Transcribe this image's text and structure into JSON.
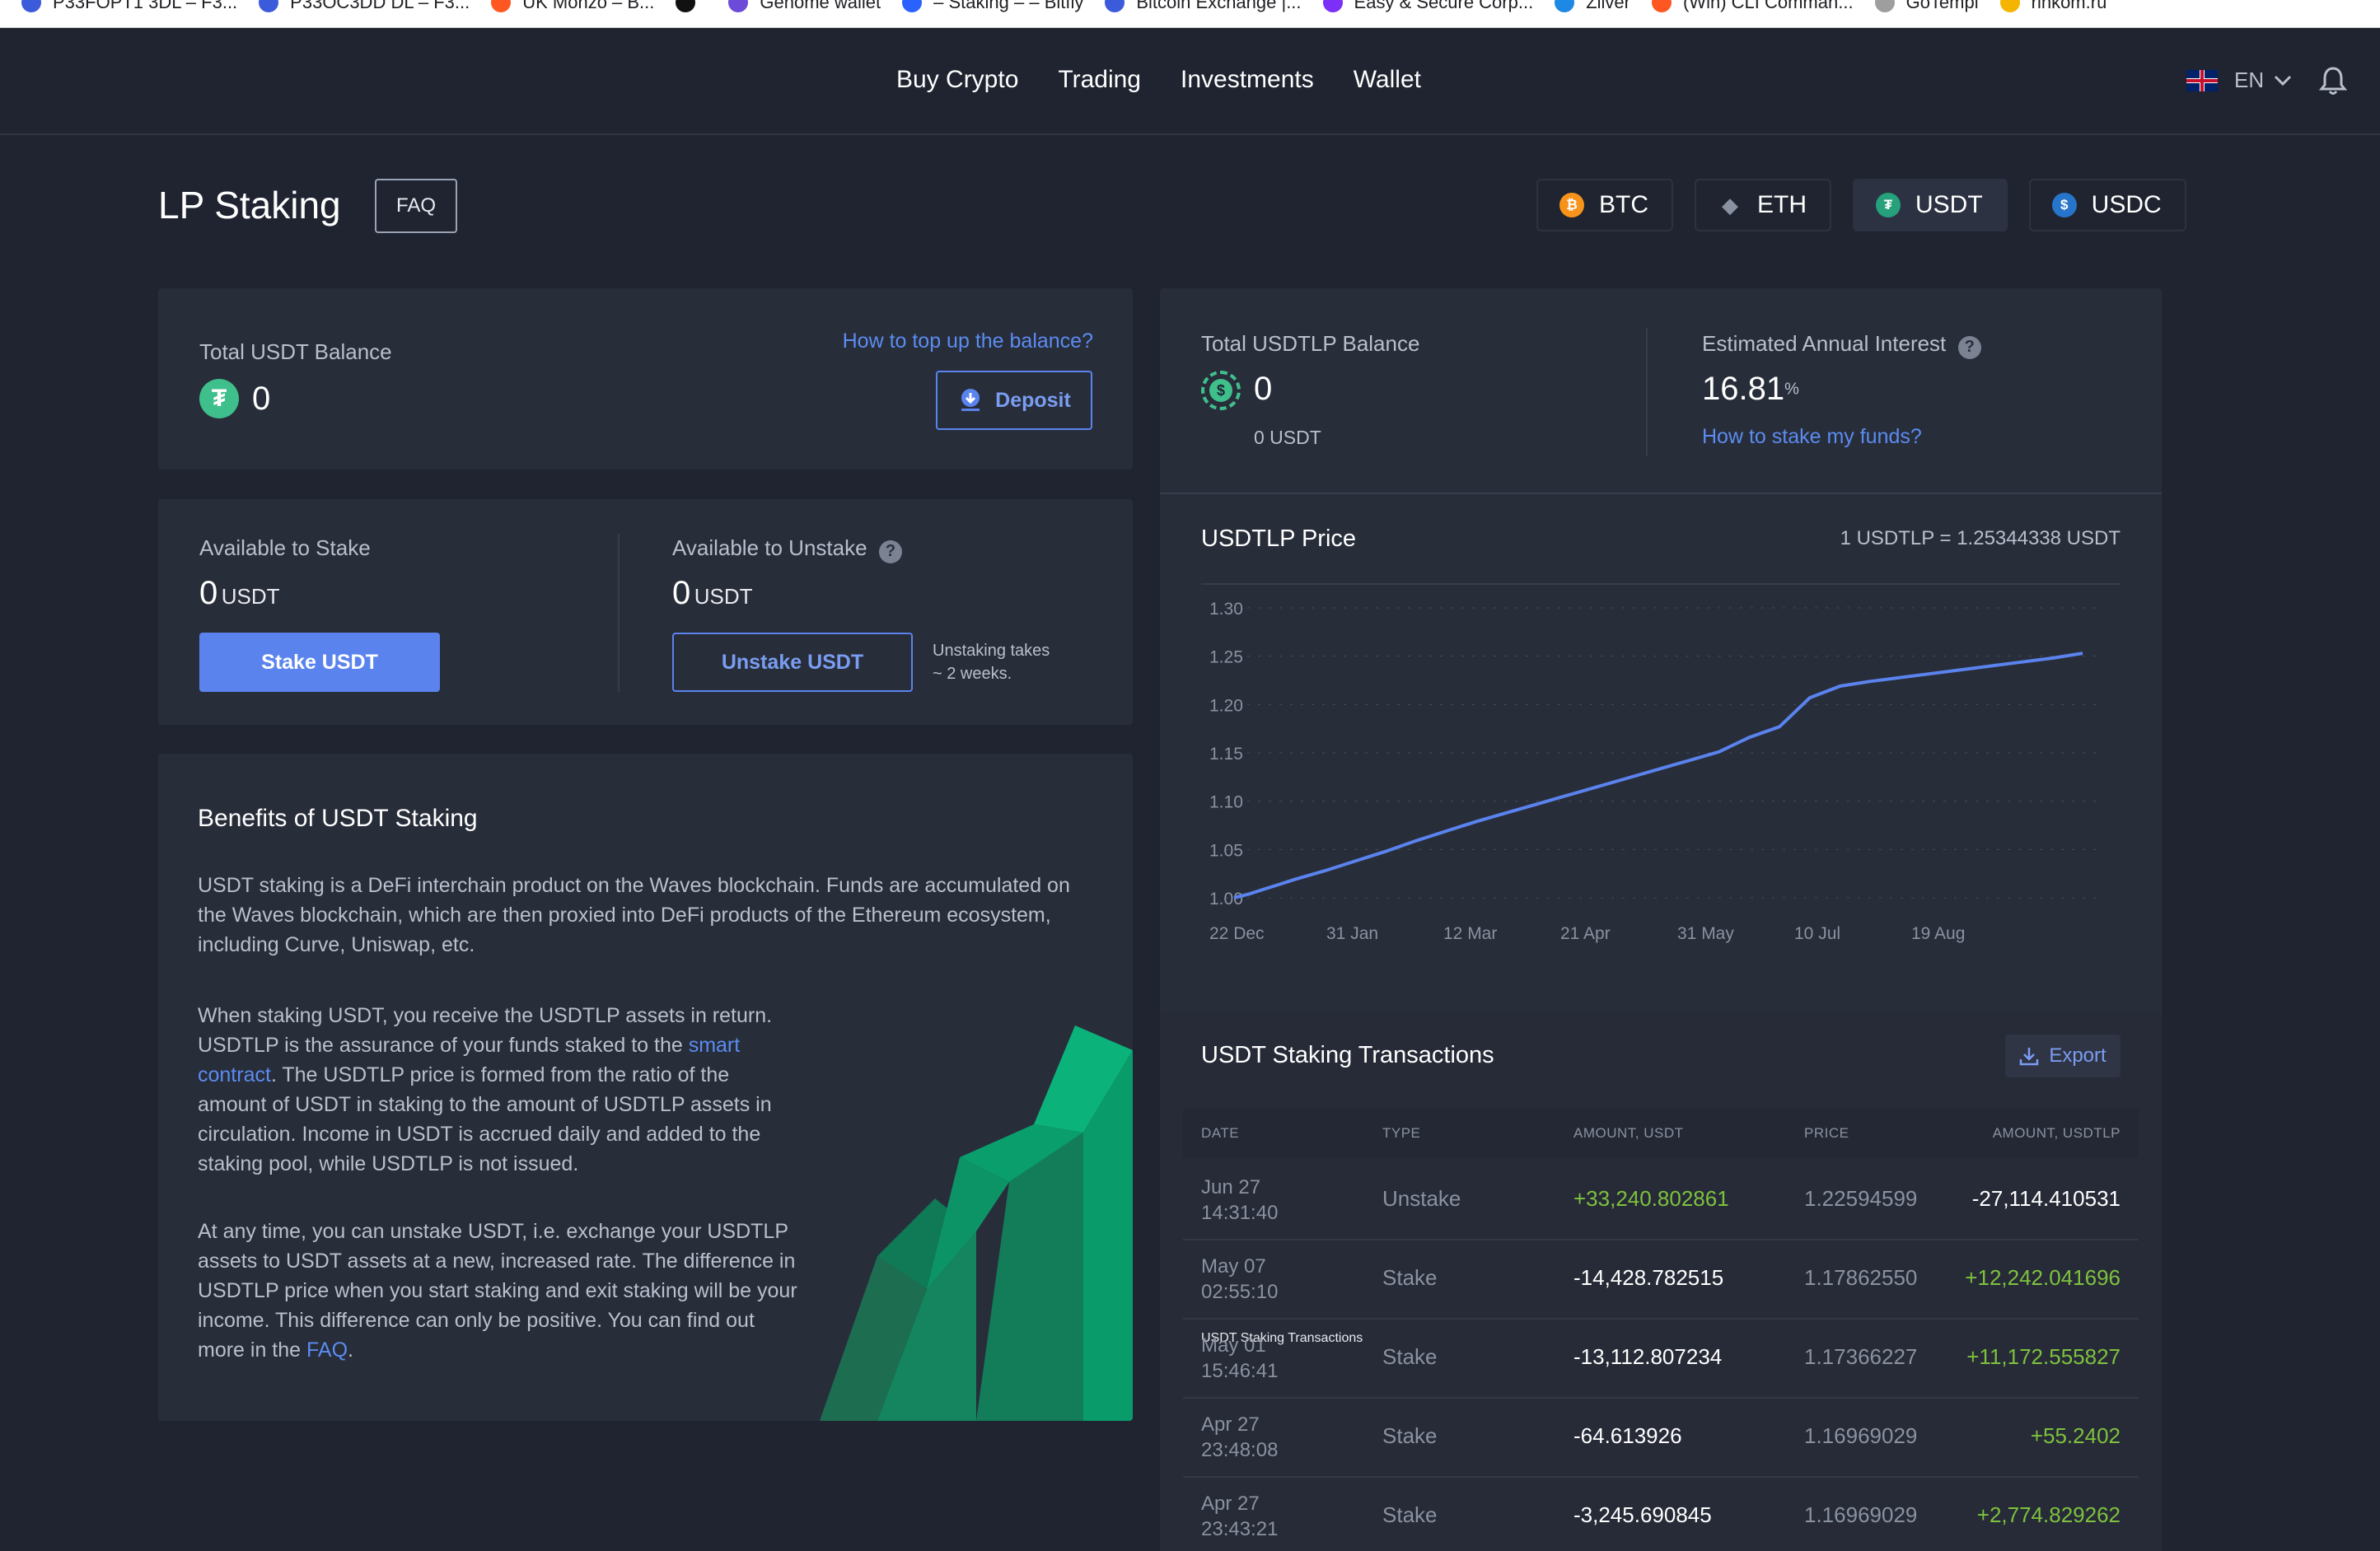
{
  "bookmarks": [
    {
      "label": "P33FOPT1 3DL – F3...",
      "color": "#3b5bdb"
    },
    {
      "label": "P33OC3DD DL – F3...",
      "color": "#3b5bdb"
    },
    {
      "label": "UK Monzo – B...",
      "color": "#ff5722"
    },
    {
      "label": "",
      "color": "#111111"
    },
    {
      "label": "Genome wallet",
      "color": "#6c4bd8"
    },
    {
      "label": "– Staking – – Bitfly",
      "color": "#2962ff"
    },
    {
      "label": "Bitcoin Exchange |...",
      "color": "#3b5bdb"
    },
    {
      "label": "Easy & Secure Corp...",
      "color": "#7b2ff7"
    },
    {
      "label": "Zilver",
      "color": "#1e88e5"
    },
    {
      "label": "(Win) CLI Comman...",
      "color": "#ff5722"
    },
    {
      "label": "GoTempl",
      "color": "#9e9e9e"
    },
    {
      "label": "rinkom.ru",
      "color": "#f4b400"
    }
  ],
  "nav": {
    "links": [
      "Buy Crypto",
      "Trading",
      "Investments",
      "Wallet"
    ],
    "language": "EN"
  },
  "header": {
    "title": "LP Staking",
    "faq": "FAQ",
    "coins": [
      {
        "label": "BTC",
        "color": "#f7931a",
        "glyph": "₿",
        "active": false
      },
      {
        "label": "ETH",
        "color": "#2c3242",
        "glyph": "◆",
        "active": false
      },
      {
        "label": "USDT",
        "color": "#26a17b",
        "glyph": "₮",
        "active": true
      },
      {
        "label": "USDC",
        "color": "#2775ca",
        "glyph": "$",
        "active": false
      }
    ]
  },
  "balance": {
    "label": "Total USDT Balance",
    "value": "0",
    "help_link": "How to top up the balance?",
    "deposit": "Deposit"
  },
  "stake": {
    "available_label": "Available to Stake",
    "available_value": "0",
    "available_unit": "USDT",
    "stake_button": "Stake USDT",
    "unstake_label": "Available to Unstake",
    "unstake_value": "0",
    "unstake_unit": "USDT",
    "unstake_button": "Unstake USDT",
    "unstake_note_1": "Unstaking takes",
    "unstake_note_2": "~ 2 weeks."
  },
  "benefits": {
    "title": "Benefits of USDT Staking",
    "p1": "USDT staking is a DeFi interchain product on the Waves blockchain. Funds are accumulated on the Waves blockchain, which are then proxied into DeFi products of the Ethereum ecosystem, including Curve, Uniswap, etc.",
    "p2_a": "When staking USDT, you receive the USDTLP assets in return. USDTLP is the assurance of your funds staked to the ",
    "p2_link": "smart contract",
    "p2_b": ". The USDTLP price is formed from the ratio of the amount of USDT in staking to the amount of USDTLP assets in circulation. Income in USDT is accrued daily and added to the staking pool, while USDTLP is not issued.",
    "p3_a": "At any time, you can unstake USDT, i.e. exchange your USDTLP assets to USDT assets at a new, increased rate. The difference in USDTLP price when you start staking and exit staking will be your income. This difference can only be positive. You can find out more in the ",
    "p3_link": "FAQ",
    "p3_b": "."
  },
  "lp": {
    "balance_label": "Total USDTLP Balance",
    "balance_value": "0",
    "balance_sub": "0 USDT",
    "interest_label": "Estimated Annual Interest",
    "interest_value": "16.81",
    "interest_unit": "%",
    "stake_link": "How to stake my funds?"
  },
  "price_panel": {
    "title": "USDTLP Price",
    "rate": "1 USDTLP = 1.25344338 USDT"
  },
  "chart_data": {
    "type": "line",
    "title": "USDTLP Price",
    "x_ticks": [
      "22 Dec",
      "31 Jan",
      "12 Mar",
      "21 Apr",
      "31 May",
      "10 Jul",
      "19 Aug"
    ],
    "y_ticks": [
      "1.00",
      "1.05",
      "1.10",
      "1.15",
      "1.20",
      "1.25",
      "1.30"
    ],
    "ylim": [
      1.0,
      1.3
    ],
    "grid": true,
    "color": "#5a83ee",
    "series": [
      {
        "x": [
          0,
          5,
          10,
          15,
          20,
          30,
          40,
          50,
          60,
          70,
          80,
          90,
          100,
          110,
          120,
          130,
          140,
          150,
          160,
          170,
          180,
          190,
          200,
          210,
          220,
          230,
          240,
          250,
          260,
          270,
          280
        ],
        "values": [
          1.0,
          1.004,
          1.009,
          1.014,
          1.019,
          1.028,
          1.038,
          1.048,
          1.059,
          1.069,
          1.079,
          1.088,
          1.097,
          1.106,
          1.115,
          1.124,
          1.133,
          1.142,
          1.151,
          1.166,
          1.177,
          1.207,
          1.219,
          1.224,
          1.228,
          1.232,
          1.236,
          1.24,
          1.244,
          1.248,
          1.253
        ]
      }
    ]
  },
  "transactions": {
    "title": "USDT Staking Transactions",
    "export": "Export",
    "columns": [
      "DATE",
      "TYPE",
      "AMOUNT, USDT",
      "PRICE",
      "AMOUNT, USDTLP"
    ],
    "rows": [
      {
        "date": "Jun 27",
        "time": "14:31:40",
        "type": "Unstake",
        "amount": "+33,240.802861",
        "price": "1.22594599",
        "amount_lp": "-27,114.410531"
      },
      {
        "date": "May 07",
        "time": "02:55:10",
        "type": "Stake",
        "amount": "-14,428.782515",
        "price": "1.17862550",
        "amount_lp": "+12,242.041696"
      },
      {
        "date": "May 01",
        "time": "15:46:41",
        "type": "Stake",
        "amount": "-13,112.807234",
        "price": "1.17366227",
        "amount_lp": "+11,172.555827"
      },
      {
        "date": "Apr 27",
        "time": "23:48:08",
        "type": "Stake",
        "amount": "-64.613926",
        "price": "1.16969029",
        "amount_lp": "+55.2402"
      },
      {
        "date": "Apr 27",
        "time": "23:43:21",
        "type": "Stake",
        "amount": "-3,245.690845",
        "price": "1.16969029",
        "amount_lp": "+2,774.829262"
      }
    ]
  }
}
